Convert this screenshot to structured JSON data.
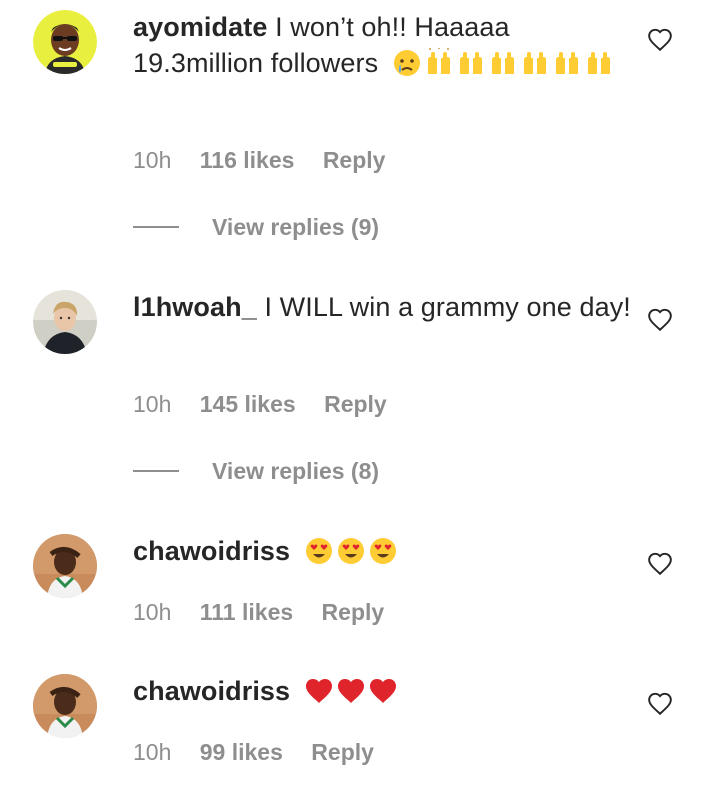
{
  "comments": [
    {
      "username": "ayomidate",
      "text": "I won’t oh!! Haaaaa 19.3million followers",
      "emojis": [
        "crying-face-emoji",
        "raising-hands-emoji",
        "raising-hands-emoji",
        "raising-hands-emoji",
        "raising-hands-emoji",
        "raising-hands-emoji",
        "raising-hands-emoji"
      ],
      "time": "10h",
      "likes": "116 likes",
      "reply": "Reply",
      "view_replies": "View replies (9)"
    },
    {
      "username": "l1hwoah_",
      "text": "I WILL win a grammy one day!",
      "time": "10h",
      "likes": "145 likes",
      "reply": "Reply",
      "view_replies": "View replies (8)"
    },
    {
      "username": "chawoidriss",
      "text": "",
      "emojis": [
        "heart-eyes-emoji",
        "heart-eyes-emoji",
        "heart-eyes-emoji"
      ],
      "time": "10h",
      "likes": "111 likes",
      "reply": "Reply"
    },
    {
      "username": "chawoidriss",
      "text": "",
      "emojis": [
        "red-heart-emoji",
        "red-heart-emoji",
        "red-heart-emoji"
      ],
      "time": "10h",
      "likes": "99 likes",
      "reply": "Reply"
    }
  ],
  "colors": {
    "text": "#262626",
    "muted": "#8e8e8e",
    "background": "#ffffff",
    "avatar1_bg": "#e8ef3f",
    "heart_red": "#e0242b",
    "emoji_yellow": "#ffcc33"
  }
}
